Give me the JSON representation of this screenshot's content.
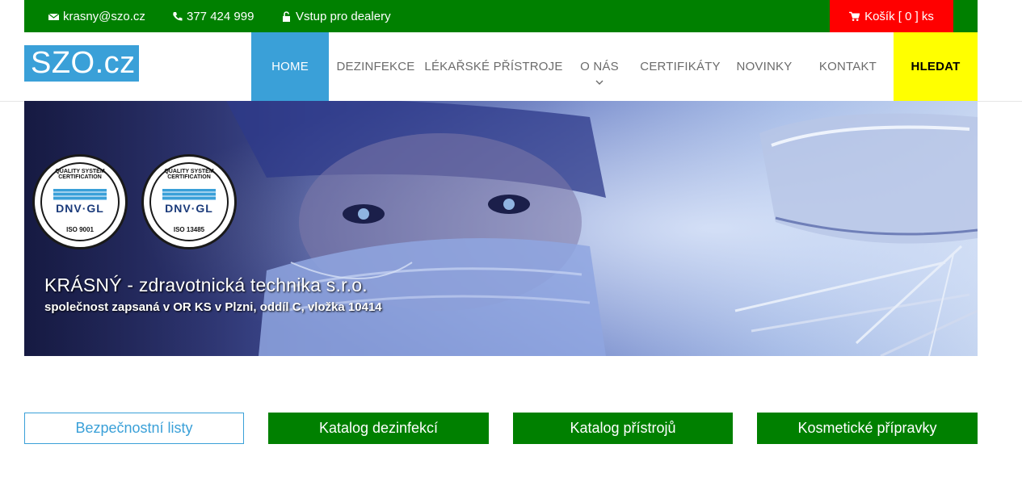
{
  "topbar": {
    "email": "krasny@szo.cz",
    "phone": "377 424 999",
    "dealer": "Vstup pro dealery",
    "cart": "Košík [ 0 ] ks"
  },
  "logo": "SZO.cz",
  "nav": {
    "home": "HOME",
    "dezinfekce": "DEZINFEKCE",
    "pristroje": "LÉKAŘSKÉ PŘÍSTROJE",
    "onas": "O NÁS",
    "certifikaty": "CERTIFIKÁTY",
    "novinky": "NOVINKY",
    "kontakt": "KONTAKT",
    "hledat": "HLEDAT"
  },
  "hero": {
    "title": "KRÁSNÝ - zdravotnická technika s.r.o.",
    "subtitle": "společnost zapsaná v OR KS v Plzni, oddíl C, vložka 10414",
    "badge1": {
      "top": "QUALITY SYSTEM CERTIFICATION",
      "brand": "DNV·GL",
      "iso": "ISO 9001"
    },
    "badge2": {
      "top": "QUALITY SYSTEM CERTIFICATION",
      "brand": "DNV·GL",
      "iso": "ISO 13485"
    }
  },
  "buttons": {
    "listy": "Bezpečnostní listy",
    "dezinfekci": "Katalog dezinfekcí",
    "pristroju": "Katalog přístrojů",
    "kosmetika": "Kosmetické přípravky"
  },
  "colors": {
    "green": "#008000",
    "red": "#ff0000",
    "blue": "#3aa0d8",
    "yellow": "#ffff00"
  }
}
